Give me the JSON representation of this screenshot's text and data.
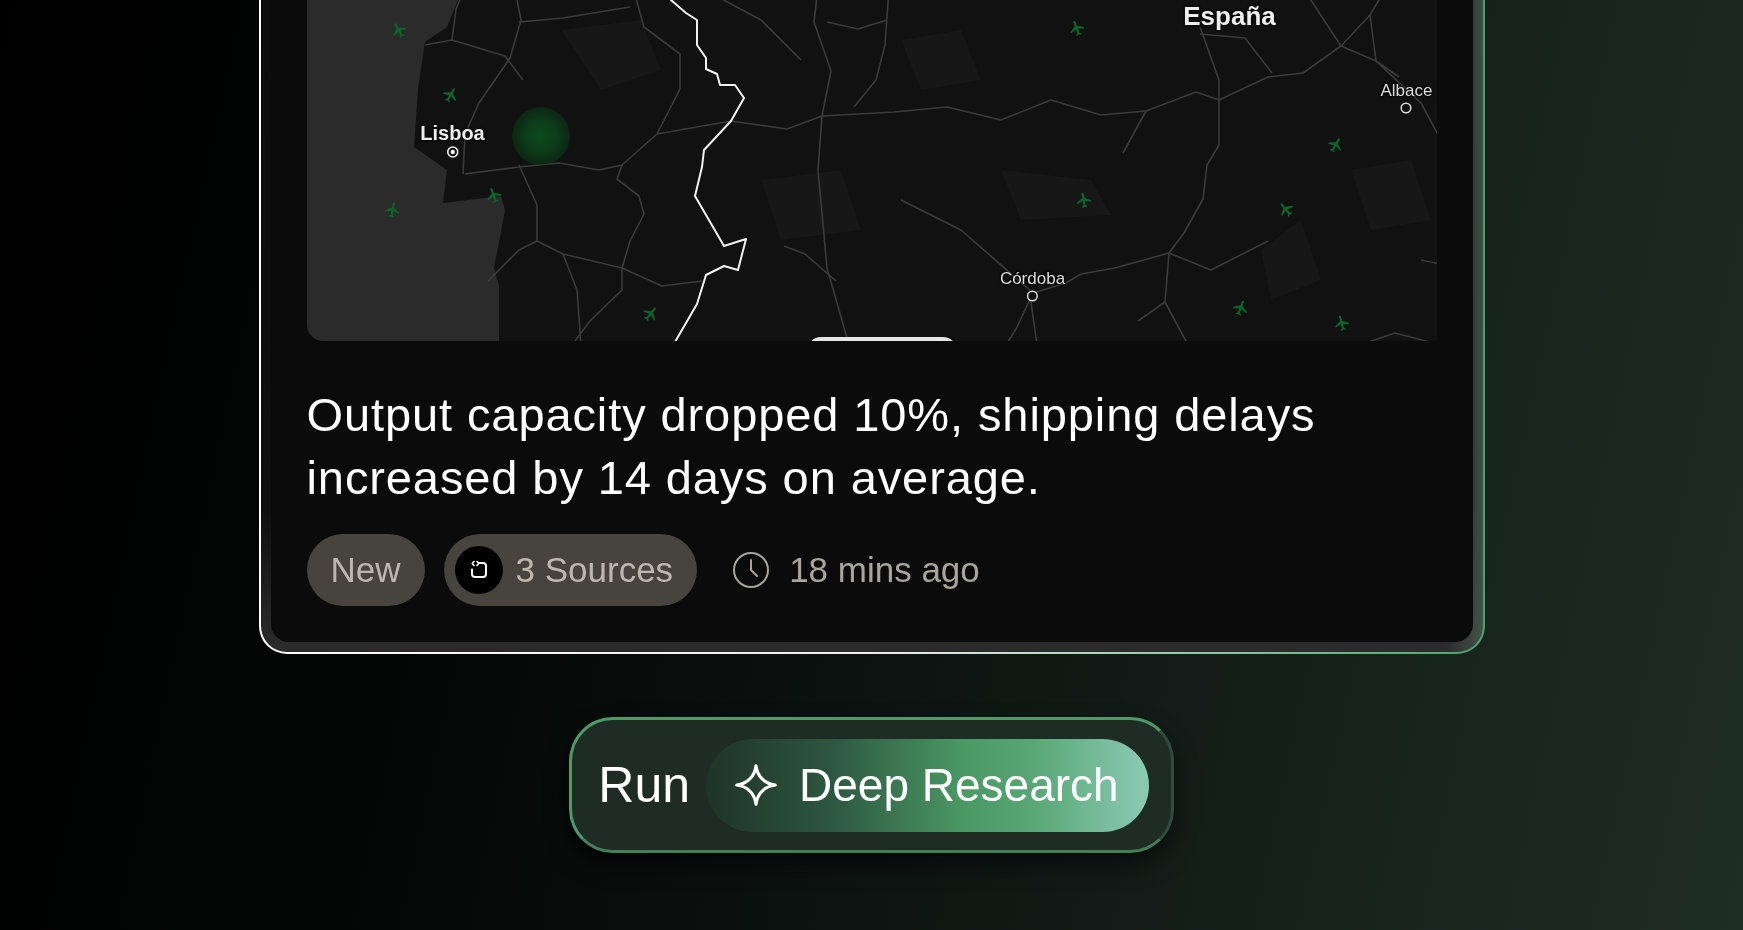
{
  "map": {
    "labels": [
      {
        "text": "España",
        "kind": "country"
      },
      {
        "text": "Lisboa",
        "kind": "capital"
      },
      {
        "text": "Córdoba",
        "kind": "city"
      },
      {
        "text": "Albace",
        "kind": "city"
      }
    ]
  },
  "summary": "Output capacity dropped 10%, shipping delays increased by 14 days on average.",
  "tags": [
    {
      "kind": "status",
      "label": "New"
    },
    {
      "kind": "sources",
      "label": "3 Sources"
    }
  ],
  "timestamp": "18 mins ago",
  "action": {
    "label": "Run",
    "mode": "Deep Research"
  }
}
